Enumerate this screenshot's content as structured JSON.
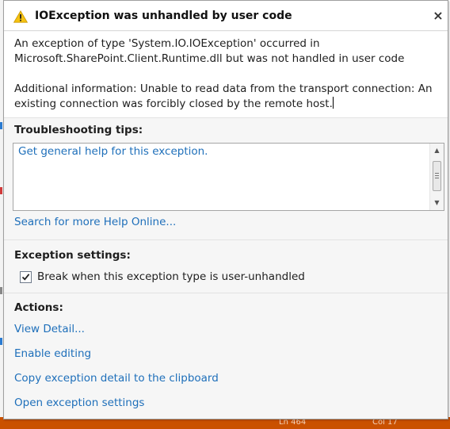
{
  "dialog": {
    "title": "IOException was unhandled by user code",
    "close_label": "×",
    "message_line1": "An exception of type 'System.IO.IOException' occurred in",
    "message_line2": "Microsoft.SharePoint.Client.Runtime.dll but was not handled in user code",
    "additional_line1": "Additional information: Unable to read data from the transport connection: An",
    "additional_line2": "existing connection was forcibly closed by the remote host."
  },
  "troubleshooting": {
    "heading": "Troubleshooting tips:",
    "tip": "Get general help for this exception.",
    "search_link": "Search for more Help Online..."
  },
  "exception_settings": {
    "heading": "Exception settings:",
    "break_label": "Break when this exception type is user-unhandled",
    "break_checked": true
  },
  "actions": {
    "heading": "Actions:",
    "items": [
      "View Detail...",
      "Enable editing",
      "Copy exception detail to the clipboard",
      "Open exception settings"
    ]
  },
  "status_bar": {
    "line": "Ln 464",
    "col": "Col 17"
  },
  "colors": {
    "link": "#1e6fba",
    "status_bar": "#ca5100",
    "warning": "#f5c211"
  }
}
